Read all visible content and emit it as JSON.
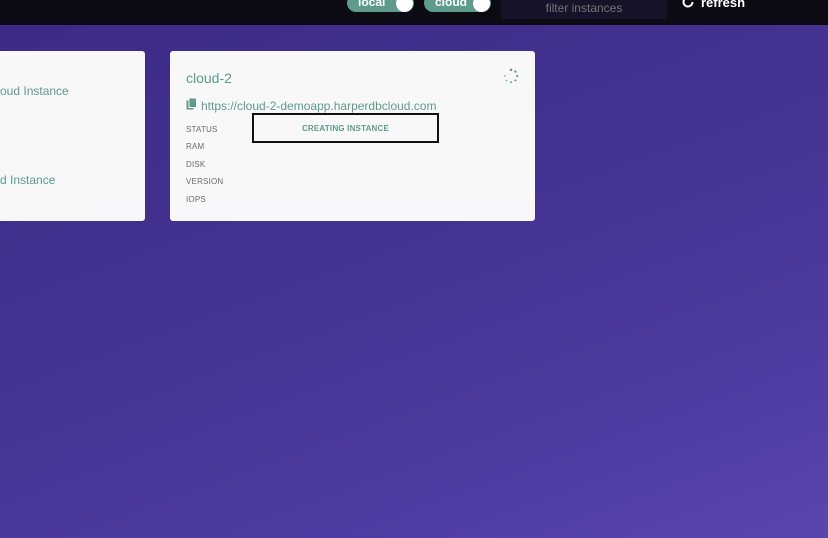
{
  "header": {
    "toggle_local_label": "local",
    "toggle_cloud_label": "cloud",
    "filter_placeholder": "filter instances",
    "refresh_label": "refresh",
    "refresh_icon": "refresh-icon"
  },
  "cards": {
    "partial_card": {
      "line1": "oud Instance",
      "line2": "d Instance"
    },
    "cloud2": {
      "title": "cloud-2",
      "url": "https://cloud-2-demoapp.harperdbcloud.com",
      "url_icon": "copy-icon",
      "status_icon": "spinner-icon",
      "labels": {
        "status": "STATUS",
        "ram": "RAM",
        "disk": "DISK",
        "version": "VERSION",
        "iops": "IOPS"
      },
      "status_value": "CREATING INSTANCE"
    }
  },
  "colors": {
    "accent": "#5e9b8a",
    "background_start": "#3d2a86",
    "background_end": "#5a45ad",
    "topbar": "#0c0a12",
    "card": "#f8f7fa"
  }
}
